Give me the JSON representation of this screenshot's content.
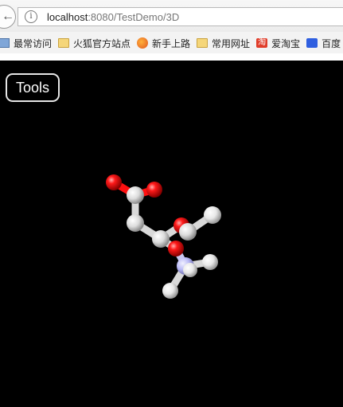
{
  "browser": {
    "url_host": "localhost",
    "url_rest": ":8080/TestDemo/3D",
    "bookmarks": [
      {
        "label": "最常访问",
        "icon": "visited-icon"
      },
      {
        "label": "火狐官方站点",
        "icon": "folder-icon"
      },
      {
        "label": "新手上路",
        "icon": "firefox-icon"
      },
      {
        "label": "常用网址",
        "icon": "folder-icon"
      },
      {
        "label": "爱淘宝",
        "icon": "taobao-icon"
      },
      {
        "label": "百度",
        "icon": "baidu-icon"
      }
    ]
  },
  "viewer": {
    "tools_label": "Tools",
    "background": "#000000",
    "atom_colors": {
      "oxygen": "#ff0d0d",
      "carbon": "#e0e0e0",
      "hydrogen": "#f5f5f5",
      "nitrogen": "#b8b8ff"
    }
  }
}
